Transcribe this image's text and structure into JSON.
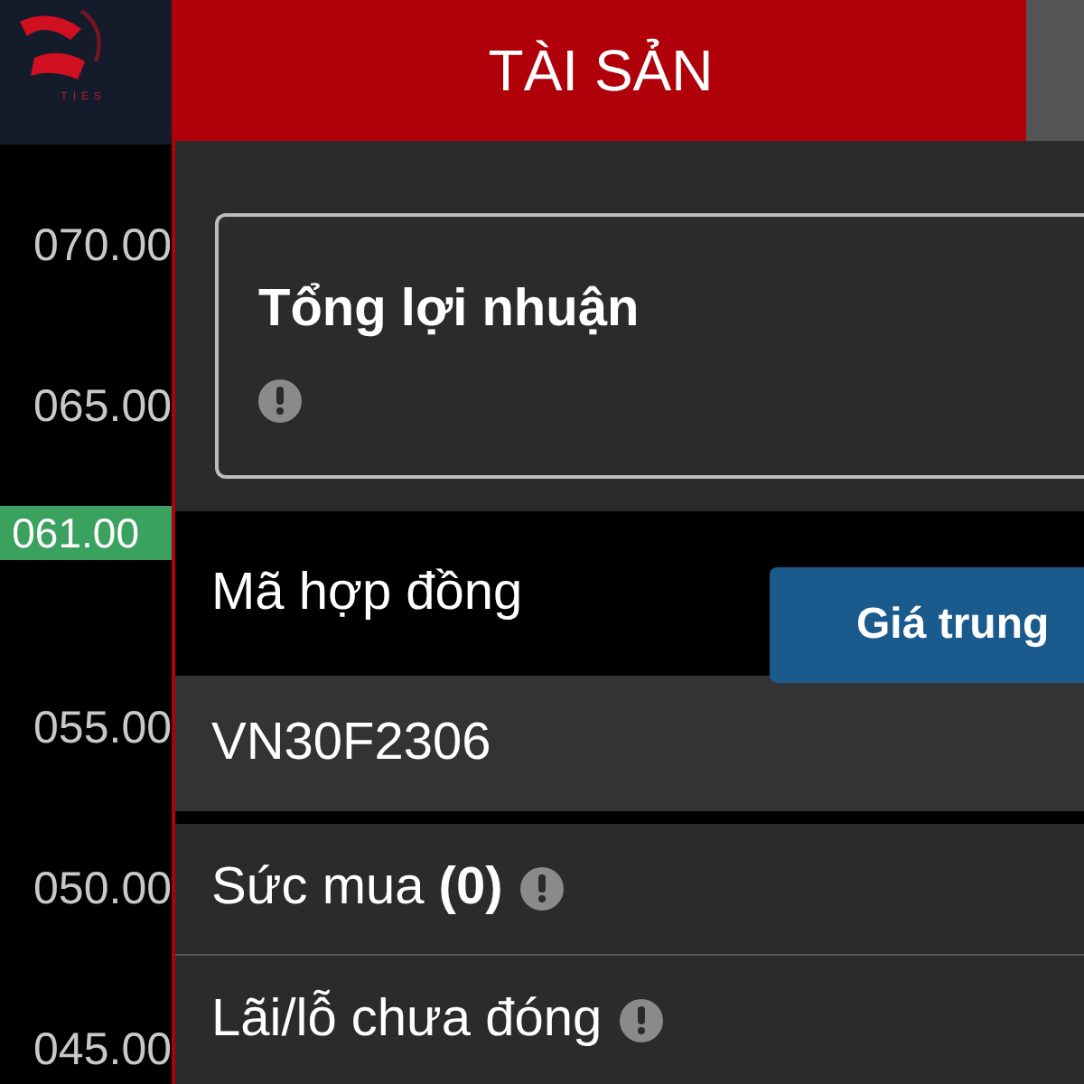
{
  "logo": {
    "text": "TIES"
  },
  "price_axis": [
    {
      "kind": "label",
      "text": "070.00"
    },
    {
      "kind": "label",
      "text": "065.00"
    },
    {
      "kind": "current",
      "text": "061.00"
    },
    {
      "kind": "label",
      "text": "055.00"
    },
    {
      "kind": "label",
      "text": "050.00"
    },
    {
      "kind": "label",
      "text": "045.00"
    }
  ],
  "header": {
    "title": "TÀI SẢN"
  },
  "profit_card": {
    "title": "Tổng lợi nhuận"
  },
  "contract": {
    "label": "Mã hợp đồng",
    "value": "VN30F2306",
    "button": "Giá trung"
  },
  "info_rows": [
    {
      "label": "Sức mua **(0)**"
    },
    {
      "label": "Lãi/lỗ chưa đóng"
    }
  ]
}
